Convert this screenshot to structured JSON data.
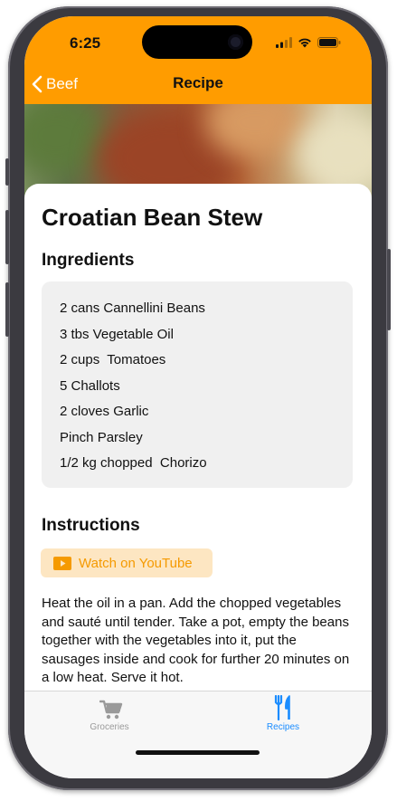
{
  "status_bar": {
    "time": "6:25"
  },
  "nav": {
    "back_label": "Beef",
    "title": "Recipe"
  },
  "recipe": {
    "title": "Croatian Bean Stew",
    "ingredients_heading": "Ingredients",
    "ingredients": [
      "2 cans Cannellini Beans",
      "3 tbs Vegetable Oil",
      "2 cups  Tomatoes",
      "5 Challots",
      "2 cloves Garlic",
      "Pinch Parsley",
      "1/2 kg chopped  Chorizo"
    ],
    "instructions_heading": "Instructions",
    "youtube_label": "Watch on YouTube",
    "instructions_text": "Heat the oil in a pan. Add the chopped vegetables and sauté until tender. Take a pot, empty the beans together with the vegetables into it, put the sausages inside and cook for further 20 minutes on a low heat. Serve it hot."
  },
  "tabs": [
    {
      "label": "Groceries",
      "icon": "cart-icon",
      "selected": false
    },
    {
      "label": "Recipes",
      "icon": "fork-knife-icon",
      "selected": true
    }
  ],
  "colors": {
    "accent": "#ff9c00",
    "tab_selected": "#1a8cff",
    "tab_unselected": "#9a9a9a",
    "youtube_bg": "#fde6c2",
    "youtube_text": "#f59a00"
  }
}
